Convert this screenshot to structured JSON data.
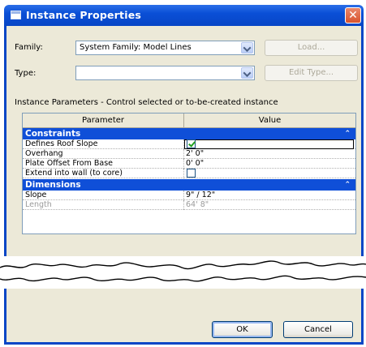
{
  "window": {
    "title": "Instance Properties",
    "close_glyph": "✕"
  },
  "family": {
    "label": "Family:",
    "value": "System Family: Model Lines",
    "load_label": "Load..."
  },
  "type": {
    "label": "Type:",
    "value": "",
    "edit_type_label": "Edit Type..."
  },
  "instance_params_label": "Instance Parameters - Control selected or to-be-created instance",
  "grid": {
    "headers": {
      "parameter": "Parameter",
      "value": "Value"
    },
    "groups": [
      {
        "name": "Constraints",
        "collapse_glyph": "⌃",
        "rows": [
          {
            "name": "Defines Roof Slope",
            "value": "",
            "checkbox": true,
            "checked": true
          },
          {
            "name": "Overhang",
            "value": "2'  0\""
          },
          {
            "name": "Plate Offset From Base",
            "value": "0'  0\""
          },
          {
            "name": "Extend into wall (to core)",
            "value": "",
            "checkbox": true,
            "checked": false
          }
        ]
      },
      {
        "name": "Dimensions",
        "collapse_glyph": "⌃",
        "rows": [
          {
            "name": "Slope",
            "value": "9\" / 12\""
          },
          {
            "name": "Length",
            "value": "64'  8\"",
            "disabled": true
          }
        ]
      }
    ]
  },
  "buttons": {
    "ok": "OK",
    "cancel": "Cancel"
  },
  "colors": {
    "title_bar": "#0a4fd6",
    "group_header": "#0f4fd8",
    "dialog_bg": "#ece9d8"
  }
}
